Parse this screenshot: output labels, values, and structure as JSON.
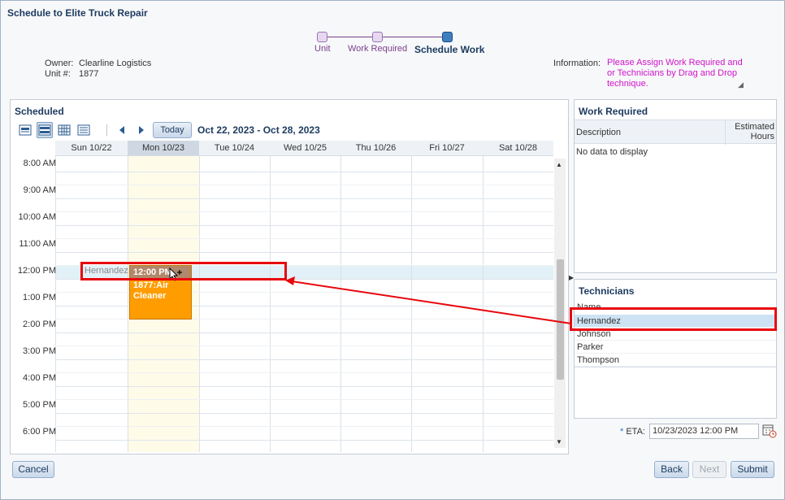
{
  "dialog": {
    "title": "Schedule to Elite Truck Repair"
  },
  "train": {
    "stops": [
      {
        "label": "Unit",
        "active": false
      },
      {
        "label": "Work Required",
        "active": false
      },
      {
        "label": "Schedule Work",
        "active": true
      }
    ]
  },
  "header": {
    "owner_label": "Owner:",
    "owner_value": "Clearline Logistics",
    "unit_label": "Unit #:",
    "unit_value": "1877",
    "information_label": "Information:",
    "information_text": "Please Assign Work Required and or Technicians by Drag and Drop technique."
  },
  "scheduled": {
    "title": "Scheduled",
    "today_label": "Today",
    "date_range": "Oct 22, 2023 - Oct 28, 2023",
    "days": [
      "Sun 10/22",
      "Mon 10/23",
      "Tue 10/24",
      "Wed 10/25",
      "Thu 10/26",
      "Fri 10/27",
      "Sat 10/28"
    ],
    "today_index": 1,
    "times": [
      "8:00 AM",
      "9:00 AM",
      "10:00 AM",
      "11:00 AM",
      "12:00 PM",
      "1:00 PM",
      "2:00 PM",
      "3:00 PM",
      "4:00 PM",
      "5:00 PM",
      "6:00 PM"
    ],
    "drag_label": "Hernandez",
    "event": {
      "time": "12:00 PM",
      "title": "1877:Air Cleaner"
    }
  },
  "work_required": {
    "title": "Work Required",
    "col_description": "Description",
    "col_hours": "Estimated Hours",
    "empty_text": "No data to display"
  },
  "technicians": {
    "title": "Technicians",
    "col_name": "Name",
    "rows": [
      "Hernandez",
      "Johnson",
      "Parker",
      "Thompson"
    ],
    "selected_index": 0
  },
  "eta": {
    "label": "ETA:",
    "required_mark": "*",
    "value": "10/23/2023 12:00 PM"
  },
  "buttons": {
    "cancel": "Cancel",
    "back": "Back",
    "next": "Next",
    "submit": "Submit"
  },
  "colors": {
    "event": "#ff9d00",
    "highlight": "#e8070c",
    "info_text": "#d014c9"
  }
}
